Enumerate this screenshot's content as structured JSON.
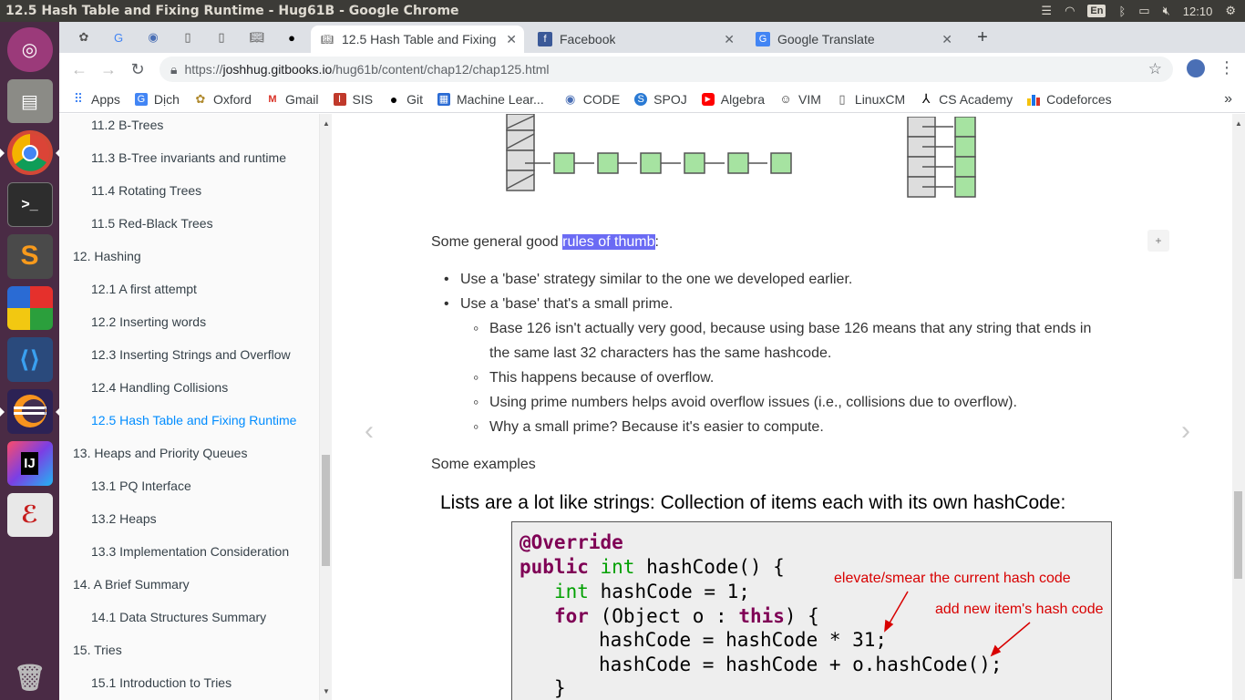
{
  "system": {
    "window_title": "12.5 Hash Table and Fixing Runtime - Hug61B - Google Chrome",
    "keyboard_layout": "En",
    "clock": "12:10"
  },
  "tabs": [
    {
      "label": "12.5 Hash Table and Fixing",
      "active": true
    },
    {
      "label": "Facebook",
      "active": false
    },
    {
      "label": "Google Translate",
      "active": false
    }
  ],
  "toolbar": {
    "url_prefix": "https://",
    "url_host": "joshhug.gitbooks.io",
    "url_path": "/hug61b/content/chap12/chap125.html"
  },
  "bookmarks": [
    "Apps",
    "Dịch",
    "Oxford",
    "Gmail",
    "SIS",
    "Git",
    "Machine Lear...",
    "CODE",
    "SPOJ",
    "Algebra",
    "VIM",
    "LinuxCM",
    "CS Academy",
    "Codeforces"
  ],
  "toc": [
    {
      "label": "11.2 B-Trees",
      "level": 2
    },
    {
      "label": "11.3 B-Tree invariants and runtime",
      "level": 2
    },
    {
      "label": "11.4 Rotating Trees",
      "level": 2
    },
    {
      "label": "11.5 Red-Black Trees",
      "level": 2
    },
    {
      "label": "12. Hashing",
      "level": 1
    },
    {
      "label": "12.1 A first attempt",
      "level": 2
    },
    {
      "label": "12.2 Inserting words",
      "level": 2
    },
    {
      "label": "12.3 Inserting Strings and Overflow",
      "level": 2
    },
    {
      "label": "12.4 Handling Collisions",
      "level": 2
    },
    {
      "label": "12.5 Hash Table and Fixing Runtime",
      "level": 2,
      "active": true
    },
    {
      "label": "13. Heaps and Priority Queues",
      "level": 1
    },
    {
      "label": "13.1 PQ Interface",
      "level": 2
    },
    {
      "label": "13.2 Heaps",
      "level": 2
    },
    {
      "label": "13.3 Implementation Consideration",
      "level": 2
    },
    {
      "label": "14. A Brief Summary",
      "level": 1
    },
    {
      "label": "14.1 Data Structures Summary",
      "level": 2
    },
    {
      "label": "15. Tries",
      "level": 1
    },
    {
      "label": "15.1 Introduction to Tries",
      "level": 2
    }
  ],
  "content": {
    "rules_intro_before": "Some general good ",
    "rules_intro_highlight": "rules of thumb",
    "rules_intro_after": ":",
    "bullets": [
      "Use a 'base' strategy similar to the one we developed earlier.",
      "Use a 'base' that's a small prime."
    ],
    "sub_bullets": [
      "Base 126 isn't actually very good, because using base 126 means that any string that ends in",
      "the same last 32 characters has the same hashcode.",
      "This happens because of overflow.",
      "Using prime numbers helps avoid overflow issues (i.e., collisions due to overflow).",
      "Why a small prime? Because it's easier to compute."
    ],
    "examples_label": "Some examples",
    "plus_label": "+"
  },
  "slide": {
    "heading": "Lists are a lot like strings: Collection of items each with its own hashCode:",
    "annotation_1": "elevate/smear the current hash code",
    "annotation_2": "add new item's hash code",
    "code": {
      "l1": "@Override",
      "l2_kw": "public",
      "l2_ty": "int",
      "l2_rest": " hashCode() {",
      "l3_ty": "int",
      "l3_rest": " hashCode = 1;",
      "l4_kw": "for",
      "l4_mid": " (Object o : ",
      "l4_kw2": "this",
      "l4_rest": ") {",
      "l5": "hashCode = hashCode * 31;",
      "l6": "hashCode = hashCode + o.hashCode();",
      "l7": "}"
    }
  }
}
